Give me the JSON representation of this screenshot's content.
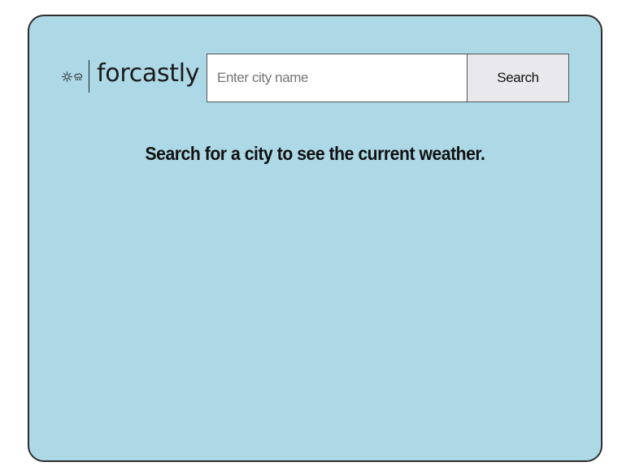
{
  "app": {
    "brand_name": "forcastly",
    "logo_icons": [
      "sun-icon",
      "cloud-rain-icon"
    ]
  },
  "search": {
    "placeholder": "Enter city name",
    "value": "",
    "button_label": "Search"
  },
  "main": {
    "message": "Search for a city to see the current weather."
  },
  "colors": {
    "card_background": "#add8e6",
    "card_border": "#2e2e2e",
    "button_background": "#e9e9ed",
    "input_background": "#ffffff"
  }
}
